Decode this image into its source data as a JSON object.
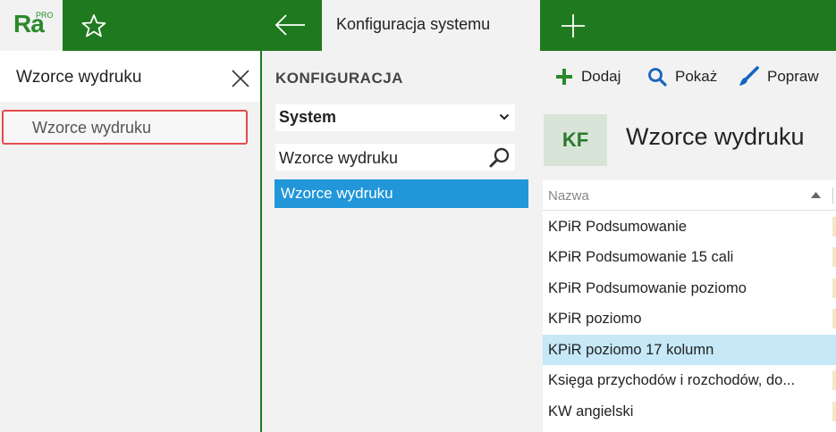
{
  "app": {
    "logo_text": "Ra",
    "logo_sup": "PRO",
    "active_tab": "Konfiguracja systemu"
  },
  "search_panel": {
    "query": "Wzorce wydruku",
    "results": [
      "Wzorce wydruku"
    ]
  },
  "config": {
    "title": "KONFIGURACJA",
    "select_value": "System",
    "filter_value": "Wzorce wydruku",
    "selected_item": "Wzorce wydruku"
  },
  "toolbar": {
    "add_label": "Dodaj",
    "show_label": "Pokaż",
    "edit_label": "Popraw"
  },
  "content": {
    "badge": "KF",
    "title": "Wzorce wydruku",
    "column_name": "Nazwa",
    "rows": [
      "KPiR Podsumowanie",
      "KPiR Podsumowanie 15 cali",
      "KPiR Podsumowanie poziomo",
      "KPiR poziomo",
      "KPiR poziomo 17 kolumn",
      "Księga przychodów i rozchodów, do...",
      "KW angielski"
    ],
    "selected_row_index": 4
  },
  "colors": {
    "brand_green": "#1f7a1f",
    "selection_blue": "#2196d9",
    "row_highlight": "#c6e8f7",
    "search_highlight_border": "#e34b4b"
  },
  "icons": [
    "star-icon",
    "arrow-left-icon",
    "plus-icon",
    "close-icon",
    "chevron-down-icon",
    "search-icon",
    "brush-icon",
    "sort-asc-icon"
  ]
}
